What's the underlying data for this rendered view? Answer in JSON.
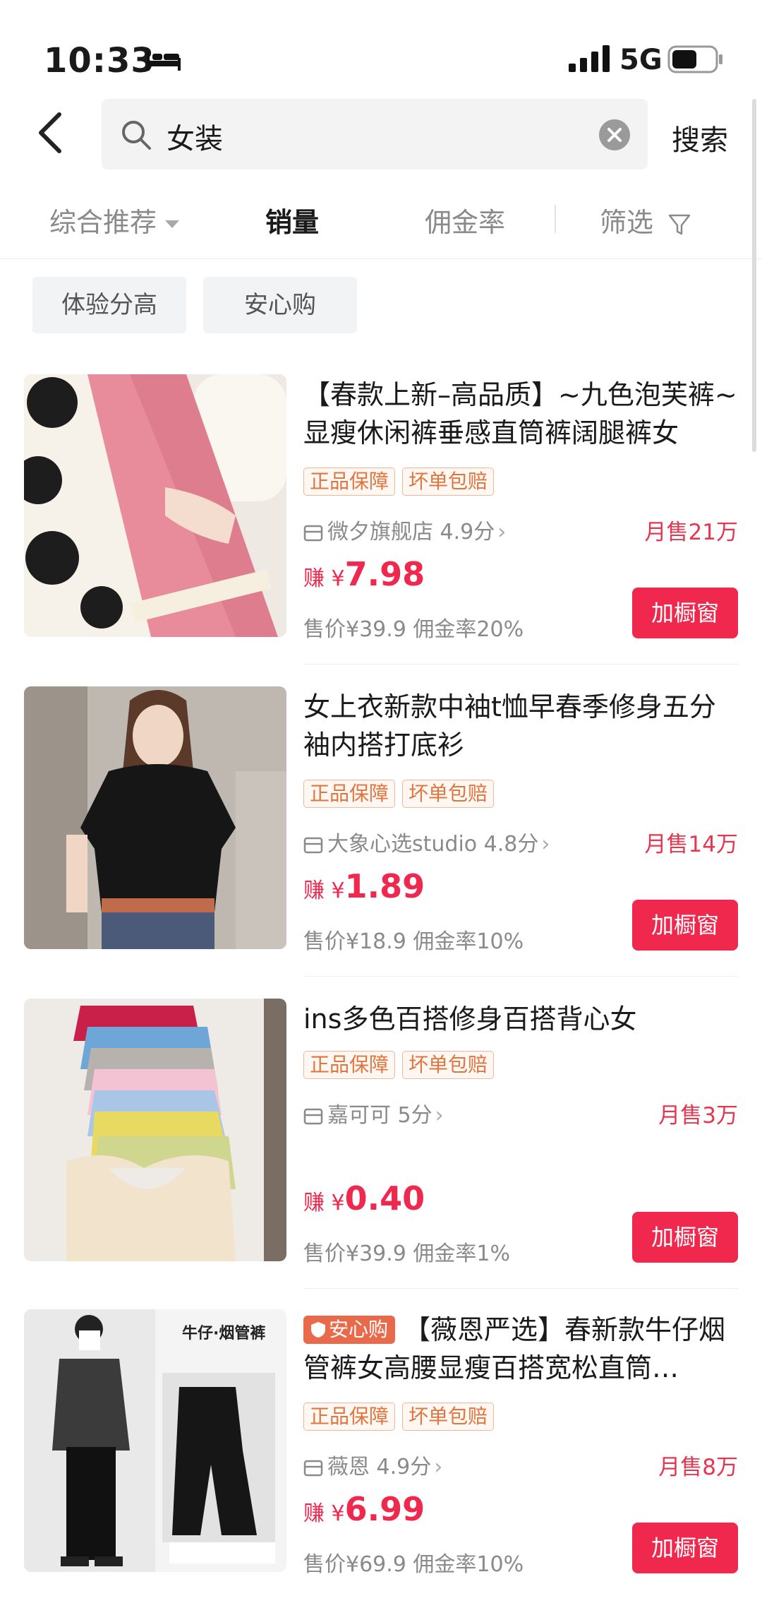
{
  "status": {
    "time": "10:33",
    "network": "5G"
  },
  "search": {
    "query": "女装",
    "button": "搜索"
  },
  "sort_tabs": [
    {
      "label": "综合推荐"
    },
    {
      "label": "销量"
    },
    {
      "label": "佣金率"
    },
    {
      "label": "筛选"
    }
  ],
  "chips": [
    "体验分高",
    "安心购"
  ],
  "products": [
    {
      "title": "【春款上新–高品质】~九色泡芙裤~显瘦休闲裤垂感直筒裤阔腿裤女",
      "tags": [
        "正品保障",
        "坏单包赔"
      ],
      "shop": "微夕旗舰店 4.9分",
      "monthly": "月售21万",
      "earn_prefix": "赚 ¥",
      "earn_amount": "7.98",
      "price_line": "售价¥39.9  佣金率20%",
      "button": "加橱窗"
    },
    {
      "title": "女上衣新款中袖t恤早春季修身五分袖内搭打底衫",
      "tags": [
        "正品保障",
        "坏单包赔"
      ],
      "shop": "大象心选studio 4.8分",
      "monthly": "月售14万",
      "earn_prefix": "赚 ¥",
      "earn_amount": "1.89",
      "price_line": "售价¥18.9  佣金率10%",
      "button": "加橱窗"
    },
    {
      "title": "ins多色百搭修身百搭背心女",
      "tags": [
        "正品保障",
        "坏单包赔"
      ],
      "shop": "嘉可可 5分",
      "monthly": "月售3万",
      "earn_prefix": "赚 ¥",
      "earn_amount": "0.40",
      "price_line": "售价¥39.9  佣金率1%",
      "button": "加橱窗"
    },
    {
      "title_tag": "安心购",
      "title": "【薇恩严选】春新款牛仔烟管裤女高腰显瘦百搭宽松直筒…",
      "tags": [
        "正品保障",
        "坏单包赔"
      ],
      "shop": "薇恩 4.9分",
      "monthly": "月售8万",
      "earn_prefix": "赚 ¥",
      "earn_amount": "6.99",
      "price_line": "售价¥69.9  佣金率10%",
      "button": "加橱窗",
      "image_caption": "牛仔·烟管裤"
    }
  ],
  "colors": {
    "accent": "#f0284e",
    "tag_border": "#f1b79c",
    "tag_text": "#e0753f"
  }
}
